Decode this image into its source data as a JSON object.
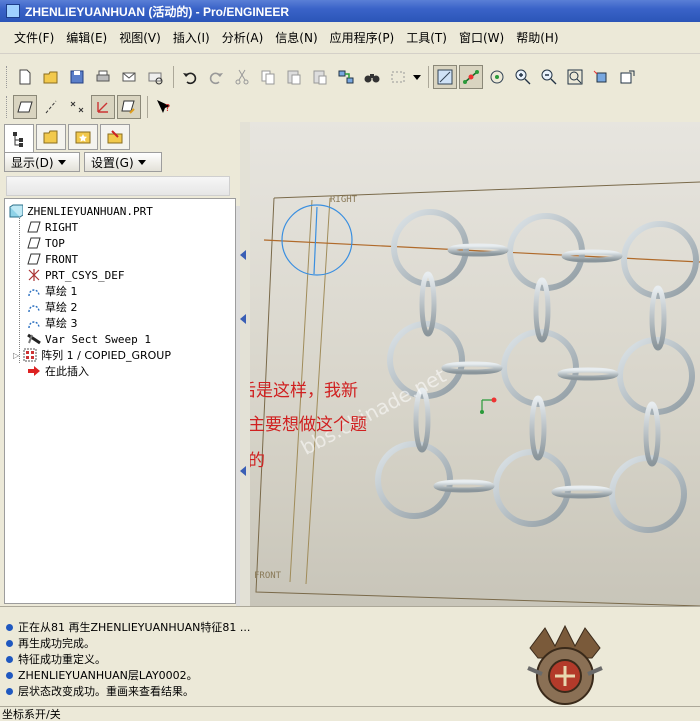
{
  "window": {
    "title": "ZHENLIEYUANHUAN (活动的) - Pro/ENGINEER"
  },
  "menu": [
    "文件(F)",
    "编辑(E)",
    "视图(V)",
    "插入(I)",
    "分析(A)",
    "信息(N)",
    "应用程序(P)",
    "工具(T)",
    "窗口(W)",
    "帮助(H)"
  ],
  "navigator": {
    "show_label": "显示(D)",
    "settings_label": "设置(G)"
  },
  "tree": {
    "items": [
      {
        "label": "ZHENLIEYUANHUAN.PRT",
        "icon": "part-icon"
      },
      {
        "label": "RIGHT",
        "icon": "datum-plane-icon"
      },
      {
        "label": "TOP",
        "icon": "datum-plane-icon"
      },
      {
        "label": "FRONT",
        "icon": "datum-plane-icon"
      },
      {
        "label": "PRT_CSYS_DEF",
        "icon": "csys-icon"
      },
      {
        "label": "草绘 1",
        "icon": "sketch-icon"
      },
      {
        "label": "草绘 2",
        "icon": "sketch-icon"
      },
      {
        "label": "草绘 3",
        "icon": "sketch-icon"
      },
      {
        "label": "Var Sect Sweep 1",
        "icon": "sweep-icon"
      },
      {
        "label": "阵列 1 / COPIED_GROUP",
        "icon": "pattern-icon"
      },
      {
        "label": "在此插入",
        "icon": "insert-arrow-icon"
      }
    ]
  },
  "viewport": {
    "datum_labels": {
      "right": "RIGHT",
      "front": "FRONT"
    },
    "watermark": "bbs.chinade.net",
    "annotation_lines": [
      "最后是这样，我新",
      "手，主要想做这个题",
      "练习的"
    ]
  },
  "messages": [
    "正在从81 再生ZHENLIEYUANHUAN特征81 ...",
    "再生成功完成。",
    "特征成功重定义。",
    "ZHENLIEYUANHUAN层LAY0002。",
    "层状态改变成功。重画来查看结果。"
  ],
  "status": {
    "text": "坐标系开/关"
  },
  "colors": {
    "title_bg": "#3a63c8",
    "accent": "#1f58c0",
    "ring": "#b8c3c8",
    "annotation": "#d02020"
  }
}
